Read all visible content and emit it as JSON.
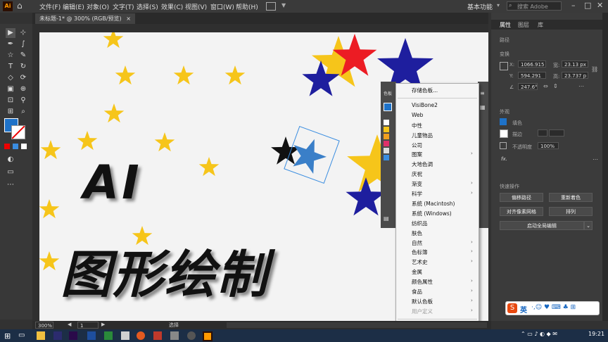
{
  "app": {
    "logo": "Ai",
    "home_icon": "home-icon"
  },
  "menubar": {
    "items": [
      "文件(F)",
      "编辑(E)",
      "对象(O)",
      "文字(T)",
      "选择(S)",
      "效果(C)",
      "视图(V)",
      "窗口(W)",
      "帮助(H)"
    ],
    "workspace": "基本功能",
    "search_placeholder": "搜索 Adobe Stock",
    "win_buttons": [
      "–",
      "□",
      "✕"
    ]
  },
  "document": {
    "tab_title": "未标题-1* @ 300% (RGB/预览)",
    "close": "×"
  },
  "canvas": {
    "title_line1": "AI",
    "title_line2": "图形绘制",
    "colors": {
      "yellow": "#f6c51a",
      "red": "#ec1c24",
      "blue": "#1e1e9e",
      "black": "#111111",
      "bg": "#f3f3f3"
    }
  },
  "right_panel": {
    "tabs": [
      "属性",
      "图层",
      "库"
    ],
    "path_label": "路径",
    "transform_label": "变换",
    "x_label": "X:",
    "x_value": "1066.915",
    "y_label": "Y:",
    "y_value": "594.291",
    "w_label": "宽:",
    "w_value": "23.13 px",
    "h_label": "高:",
    "h_value": "23.737 p",
    "angle_value": "247.6°",
    "appearance_label": "外观",
    "fill_label": "填色",
    "stroke_label": "描边",
    "opacity_label": "不透明度",
    "opacity_value": "100%",
    "fx_label": "fx.",
    "quick_actions_label": "快速操作",
    "btn_offset_path": "偏移路径",
    "btn_recolor": "重新着色",
    "btn_align_pixel": "对齐像素网格",
    "btn_arrange": "排列",
    "btn_global_edit": "启动全局编辑"
  },
  "swatch_panel": {
    "title": "色板"
  },
  "dropdown": {
    "items": [
      {
        "label": "存储色板...",
        "arrow": false
      },
      {
        "label": "VisiBone2",
        "arrow": false
      },
      {
        "label": "Web",
        "arrow": false
      },
      {
        "label": "中性",
        "arrow": false
      },
      {
        "label": "儿童物品",
        "arrow": false
      },
      {
        "label": "公司",
        "arrow": false
      },
      {
        "label": "图案",
        "arrow": true
      },
      {
        "label": "大地色调",
        "arrow": false
      },
      {
        "label": "庆祝",
        "arrow": false
      },
      {
        "label": "渐变",
        "arrow": true
      },
      {
        "label": "科学",
        "arrow": true
      },
      {
        "label": "系统 (Macintosh)",
        "arrow": false
      },
      {
        "label": "系统 (Windows)",
        "arrow": false
      },
      {
        "label": "纺织品",
        "arrow": false
      },
      {
        "label": "肤色",
        "arrow": false
      },
      {
        "label": "自然",
        "arrow": true
      },
      {
        "label": "色标簿",
        "arrow": true
      },
      {
        "label": "艺术史",
        "arrow": true
      },
      {
        "label": "金属",
        "arrow": false
      },
      {
        "label": "颜色属性",
        "arrow": true
      },
      {
        "label": "食品",
        "arrow": true
      },
      {
        "label": "默认色板",
        "arrow": true
      },
      {
        "label": "用户定义",
        "arrow": true,
        "disabled": true
      },
      {
        "label": "其它库(O)...",
        "arrow": false
      }
    ],
    "arrow_glyph": "›"
  },
  "statusbar": {
    "zoom": "300%",
    "artboard": "1",
    "tool": "选择"
  },
  "taskbar": {
    "time": "19:21"
  },
  "ime": {
    "lang": "英",
    "icons": "·,☺ ♥ ⌨ ♣ ⊞"
  }
}
